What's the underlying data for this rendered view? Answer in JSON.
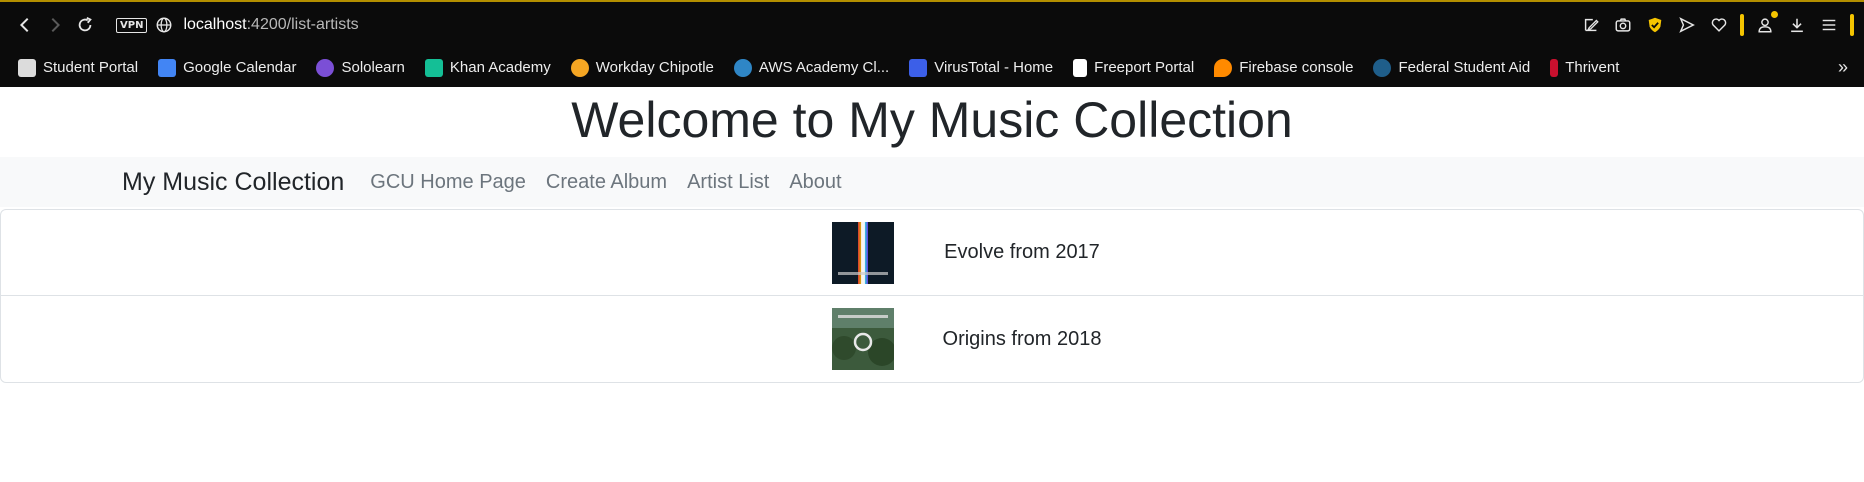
{
  "browser": {
    "vpn_label": "VPN",
    "url_host": "localhost",
    "url_path": ":4200/list-artists",
    "bookmarks": [
      {
        "label": "Student Portal",
        "color": "#dcdcdc"
      },
      {
        "label": "Google Calendar",
        "color": "#4285f4"
      },
      {
        "label": "Sololearn",
        "color": "#7b4fd6"
      },
      {
        "label": "Khan Academy",
        "color": "#14bf96"
      },
      {
        "label": "Workday Chipotle",
        "color": "#f5a623"
      },
      {
        "label": "AWS Academy Cl...",
        "color": "#2f86c6"
      },
      {
        "label": "VirusTotal - Home",
        "color": "#3c5fe8"
      },
      {
        "label": "Freeport Portal",
        "color": "#ffffff"
      },
      {
        "label": "Firebase console",
        "color": "#ff8a00"
      },
      {
        "label": "Federal Student Aid",
        "color": "#1f5e8a"
      },
      {
        "label": "Thrivent",
        "color": "#c8102e"
      }
    ],
    "more_label": "»"
  },
  "page": {
    "heading": "Welcome to My Music Collection"
  },
  "navbar": {
    "brand": "My Music Collection",
    "links": [
      "GCU Home Page",
      "Create Album",
      "Artist List",
      "About"
    ]
  },
  "albums": [
    {
      "text": "Evolve from 2017",
      "cover": "evolve-cover"
    },
    {
      "text": "Origins from 2018",
      "cover": "origins-cover"
    }
  ]
}
